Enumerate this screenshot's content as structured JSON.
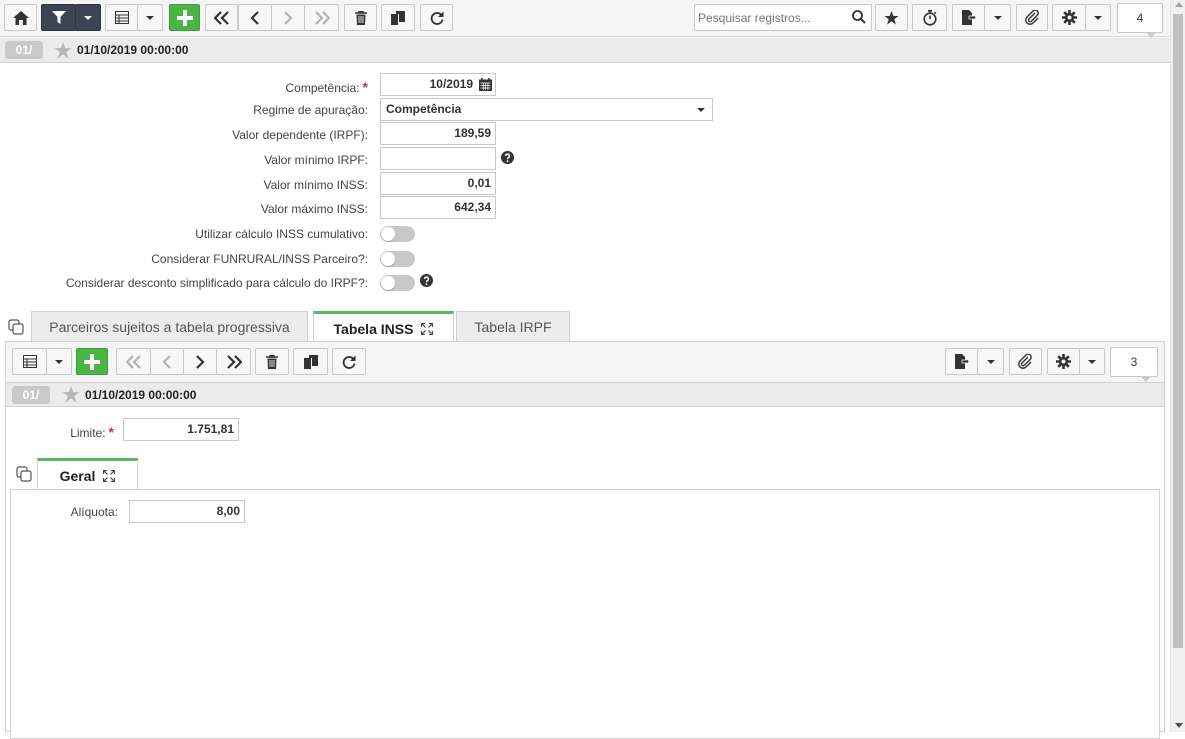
{
  "toolbar": {
    "search_placeholder": "Pesquisar registros...",
    "record_count": "4",
    "icons": [
      "home-icon",
      "filter-icon",
      "grid-icon",
      "plus-icon",
      "first-icon",
      "prev-icon",
      "next-icon",
      "last-icon",
      "trash-icon",
      "copy-icon",
      "refresh-icon",
      "search-icon",
      "star-icon",
      "timer-icon",
      "report-icon",
      "attach-icon",
      "gear-icon"
    ]
  },
  "record": {
    "badge": "01/",
    "date": "01/10/2019 00:00:00"
  },
  "form": {
    "competencia": {
      "label": "Competência:",
      "value": "10/2019",
      "required": "*"
    },
    "regime": {
      "label": "Regime de apuração:",
      "value": "Competência"
    },
    "valor_dependente": {
      "label": "Valor dependente (IRPF):",
      "value": "189,59"
    },
    "valor_minimo_irpf": {
      "label": "Valor mínimo IRPF:",
      "value": ""
    },
    "valor_minimo_inss": {
      "label": "Valor mínimo INSS:",
      "value": "0,01"
    },
    "valor_maximo_inss": {
      "label": "Valor máximo INSS:",
      "value": "642,34"
    },
    "inss_cumulativo": {
      "label": "Utilizar cálculo INSS cumulativo:",
      "checked": false
    },
    "funrural": {
      "label": "Considerar FUNRURAL/INSS Parceiro?:",
      "checked": false
    },
    "desconto_simplificado": {
      "label": "Considerar desconto simplificado para cálculo do IRPF?:",
      "checked": false
    }
  },
  "tabs": [
    {
      "label": "Parceiros sujeitos a tabela progressiva",
      "active": false
    },
    {
      "label": "Tabela INSS",
      "active": true
    },
    {
      "label": "Tabela IRPF",
      "active": false
    }
  ],
  "sub": {
    "record_count": "3",
    "record": {
      "badge": "01/",
      "date": "01/10/2019 00:00:00"
    },
    "limite": {
      "label": "Limite:",
      "value": "1.751,81",
      "required": "*"
    },
    "inner_tab": {
      "label": "Geral"
    },
    "aliquota": {
      "label": "Alíquota:",
      "value": "8,00"
    }
  },
  "colors": {
    "accent_green": "#49b545",
    "dark_button": "#3b4450",
    "required_red": "#d9302c",
    "tab_active_border": "#5cb85c"
  }
}
